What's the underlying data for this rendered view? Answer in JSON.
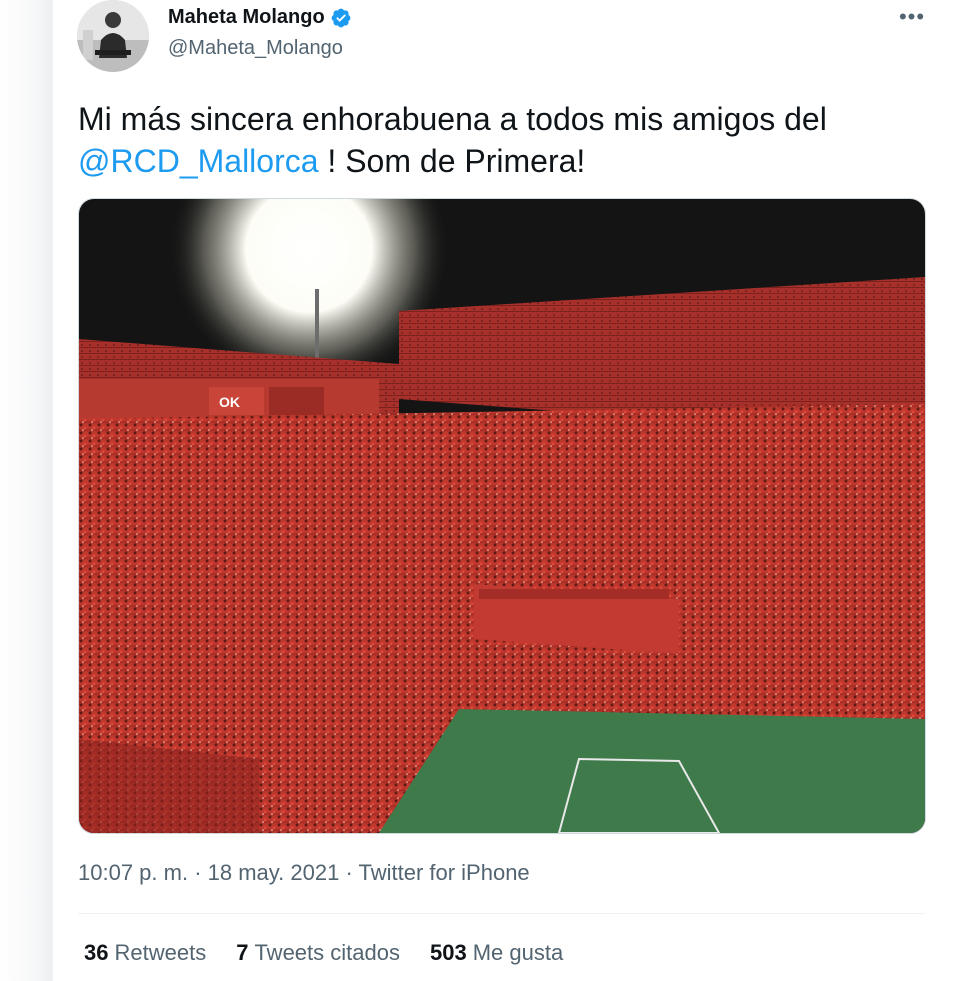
{
  "tweet": {
    "author": {
      "display_name": "Maheta Molango",
      "handle": "@Maheta_Molango",
      "verified": true,
      "avatar_icon": "avatar-photo"
    },
    "more_icon": "more-options-icon",
    "text": {
      "part1": "Mi más sincera enhorabuena a todos mis amigos del",
      "mention": "@RCD_Mallorca",
      "part2": " ! Som de Primera!"
    },
    "media_icon": "stadium-celebration-photo",
    "meta": {
      "time": "10:07 p. m.",
      "separator": " · ",
      "date": "18 may. 2021",
      "source": "Twitter for iPhone"
    },
    "stats": {
      "retweets_count": "36",
      "retweets_label": "Retweets",
      "quotes_count": "7",
      "quotes_label": "Tweets citados",
      "likes_count": "503",
      "likes_label": "Me gusta"
    }
  },
  "colors": {
    "accent": "#1d9bf0",
    "secondary_text": "#536471",
    "primary_text": "#0f1419",
    "border": "#eff3f4"
  }
}
